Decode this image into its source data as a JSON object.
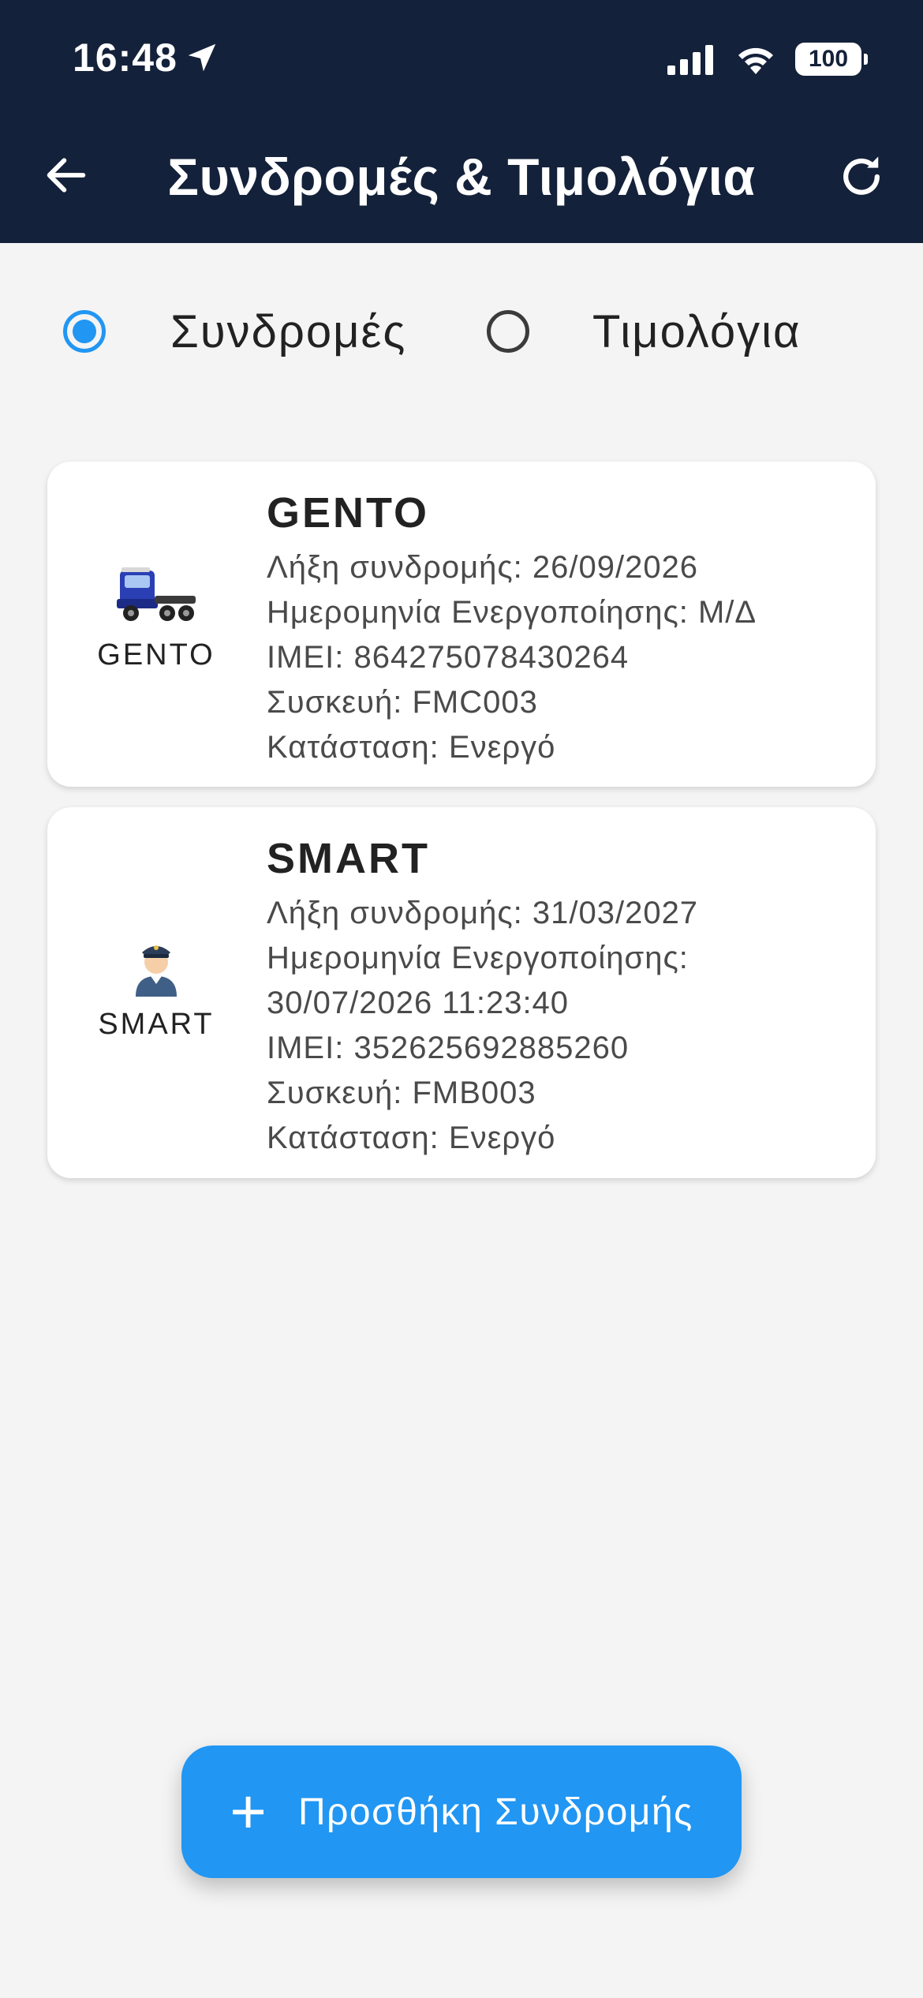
{
  "status_bar": {
    "time": "16:48",
    "battery": "100"
  },
  "header": {
    "title": "Συνδρομές & Τιμολόγια"
  },
  "tabs": {
    "subscriptions_label": "Συνδρομές",
    "invoices_label": "Τιμολόγια",
    "selected": "subscriptions"
  },
  "subscriptions": [
    {
      "title": "GENTO",
      "icon_label": "GENTO",
      "icon": "truck-icon",
      "lines": [
        "Λήξη συνδρομής: 26/09/2026",
        "Ημερομηνία Ενεργοποίησης: Μ/Δ",
        "IMEI: 864275078430264",
        "Συσκευή: FMC003",
        "Κατάσταση: Ενεργό"
      ]
    },
    {
      "title": "SMART",
      "icon_label": "SMART",
      "icon": "driver-icon",
      "lines": [
        "Λήξη συνδρομής: 31/03/2027",
        "Ημερομηνία Ενεργοποίησης:",
        "30/07/2026 11:23:40",
        "IMEI: 352625692885260",
        "Συσκευή: FMB003",
        "Κατάσταση: Ενεργό"
      ]
    }
  ],
  "fab": {
    "label": "Προσθήκη Συνδρομής",
    "icon": "plus-icon"
  },
  "colors": {
    "header_bg": "#14213a",
    "accent": "#2196f3",
    "page_bg": "#f4f4f4"
  }
}
